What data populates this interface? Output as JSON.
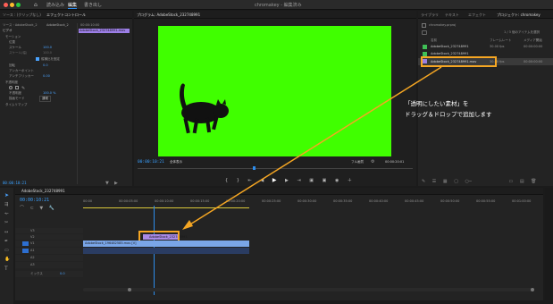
{
  "window": {
    "title": "chromakey - 編集済み"
  },
  "workspaces": [
    {
      "label": "読み込み"
    },
    {
      "label": "編集"
    },
    {
      "label": "書き出し"
    }
  ],
  "source_panel": {
    "tabs": [
      "ソース : (クリップなし)",
      "エフェクトコントロール"
    ],
    "clip_name": "ソース・AdobeStock_2",
    "seq_name": "AdobeStock_2",
    "clip_bar_label": "AdobeStock_232748991.mov",
    "timecode": "00:00:10:00",
    "video_label": "ビデオ",
    "rows": [
      {
        "label": "モーション"
      },
      {
        "label": "位置"
      },
      {
        "label": "スケール",
        "value": "100.0"
      },
      {
        "label": "スケール(幅)",
        "value": "100.0"
      },
      {
        "label": "縦横比を固定"
      },
      {
        "label": "回転",
        "value": "0.0"
      },
      {
        "label": "アンカーポイント"
      },
      {
        "label": "アンチフリッカー",
        "value": "0.00"
      },
      {
        "label": "不透明度"
      },
      {
        "label": "不透明度",
        "value": "100.0 %"
      },
      {
        "label": "描画モード",
        "value": "通常"
      },
      {
        "label": "タイムリマップ"
      }
    ],
    "bottom_timecode": "00:00:10:21"
  },
  "program_monitor": {
    "tab": "プログラム: AdobeStock_232748991",
    "timecode_current": "00:00:10:21",
    "fit_label": "全体表示",
    "quality_label": "フル画質",
    "timecode_duration": "00:00:20:01"
  },
  "project_panel": {
    "tabs": [
      "ライブラリ",
      "テキスト",
      "エフェクト",
      "プロジェクト: chromakey"
    ],
    "project_file": "chromakey.prproj",
    "count": "1 / 3 個のアイテムを選択",
    "headers": {
      "name": "名前",
      "framerate": "フレームレート",
      "media_start": "メディア開始"
    },
    "items": [
      {
        "name": "AdobeStock_232748991",
        "fps": "30.00 fps",
        "start": "00:00:00:00",
        "color": "#3fbf56"
      },
      {
        "name": "AdobeStock_232748991",
        "fps": "",
        "start": "",
        "color": "#3fbf56"
      },
      {
        "name": "AdobeStock_232748991.mov",
        "fps": "30.00 fps",
        "start": "00:00:00:00",
        "color": "#9b7fe0",
        "selected": true
      }
    ]
  },
  "timeline": {
    "tab": "AdobeStock_232748991",
    "timecode": "00:00:10:21",
    "ruler": [
      "00:00",
      "00:00:05:00",
      "00:00:10:00",
      "00:00:15:00",
      "00:00:20:00",
      "00:00:25:00",
      "00:00:30:00",
      "00:00:35:00",
      "00:00:40:00",
      "00:00:45:00",
      "00:00:50:00",
      "00:00:55:00",
      "00:01:00:00"
    ],
    "tracks": [
      "V3",
      "V2",
      "V1",
      "A1",
      "A2",
      "A3"
    ],
    "mix_label": "ミックス",
    "mix_value": "0.0",
    "clip_v2": "AdobeStock_232748991",
    "clip_v1": "AdobeStock_196482585.mov [V]"
  },
  "annotation": {
    "line1": "「透明にしたい素材」を",
    "line2": "ドラッグ＆ドロップで追加します",
    "highlight_color": "#f5a623"
  }
}
